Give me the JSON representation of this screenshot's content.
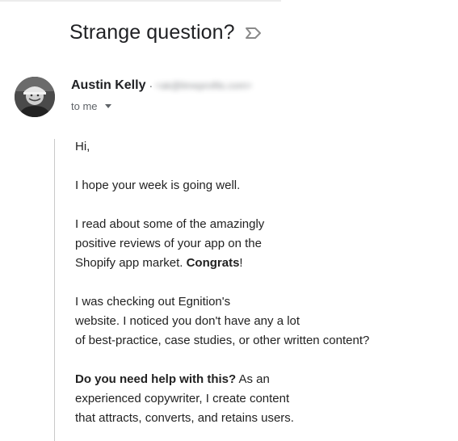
{
  "email": {
    "subject": "Strange question?",
    "sender": {
      "name": "Austin Kelly",
      "separator": "·",
      "email": "<ak@limeprofits.com>"
    },
    "recipient": {
      "label": "to me"
    },
    "body": {
      "greeting": "Hi,",
      "p1": "I hope your week is going well.",
      "p2_line1": "I read about some of the amazingly",
      "p2_line2": "positive reviews of your app on the",
      "p2_line3_text": "Shopify app market. ",
      "p2_line3_bold": "Congrats",
      "p2_line3_end": "!",
      "p3_line1": "I was checking out Egnition's",
      "p3_line2": "website. I noticed you don't have any a lot",
      "p3_line3": "of best-practice, case studies, or other written content?",
      "p4_line1_bold": "Do you need help with this?",
      "p4_line1_text": " As an",
      "p4_line2": "experienced copywriter, I create content",
      "p4_line3": "that attracts, converts, and retains users."
    }
  },
  "icons": {
    "label": "label-important-icon",
    "avatar": "sender-avatar",
    "caret": "chevron-down-icon"
  },
  "colors": {
    "text": "#202124",
    "body_text": "#222222",
    "meta": "#5f6368",
    "quote_bar": "#c9c9c9"
  }
}
